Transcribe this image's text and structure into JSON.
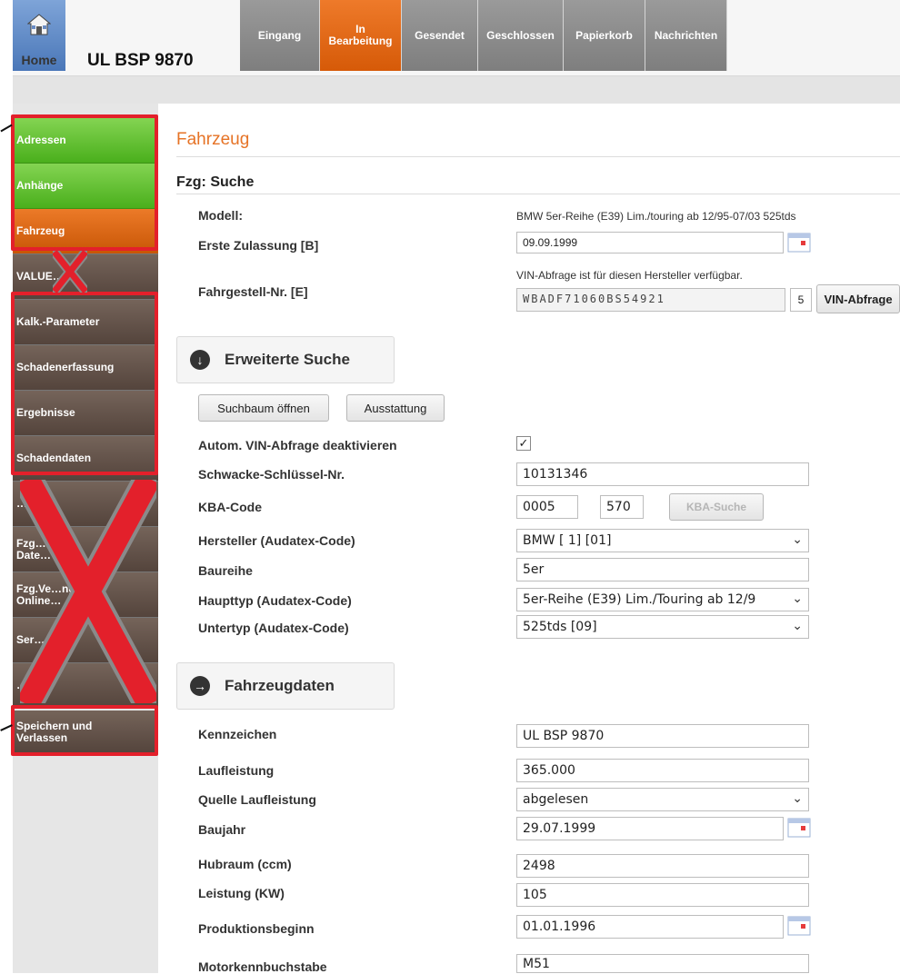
{
  "header": {
    "home_label": "Home",
    "car_title": "UL BSP 9870",
    "tabs": [
      {
        "label": "Eingang"
      },
      {
        "label": "In Bearbeitung"
      },
      {
        "label": "Gesendet"
      },
      {
        "label": "Geschlossen"
      },
      {
        "label": "Papierkorb"
      },
      {
        "label": "Nachrichten"
      }
    ]
  },
  "sidebar": {
    "items": [
      {
        "label": "Adressen"
      },
      {
        "label": "Anhänge"
      },
      {
        "label": "Fahrzeug"
      },
      {
        "label": "VALUE…pt"
      },
      {
        "label": "Kalk.-Parameter"
      },
      {
        "label": "Schadenerfassung"
      },
      {
        "label": "Ergebnisse"
      },
      {
        "label": "Schadendaten"
      },
      {
        "label": "…"
      },
      {
        "label": "Fzg…\nDate…"
      },
      {
        "label": "Fzg.Ve…ng\nOnline…"
      },
      {
        "label": "Ser…"
      },
      {
        "label": "…"
      },
      {
        "label": "Speichern und\nVerlassen"
      }
    ]
  },
  "main": {
    "section_title": "Fahrzeug",
    "search_title": "Fzg: Suche",
    "modell_label": "Modell:",
    "modell_value": "BMW 5er-Reihe (E39) Lim./touring ab 12/95-07/03 525tds",
    "erstzulassung_label": "Erste Zulassung [B]",
    "erstzulassung_value": "09.09.1999",
    "vin_hint": "VIN-Abfrage ist für diesen Hersteller verfügbar.",
    "fahrgestell_label": "Fahrgestell-Nr. [E]",
    "vin_value": "WBADF71060BS54921",
    "vin_check": "5",
    "vin_button": "VIN-Abfrage",
    "erweiterte_suche": "Erweiterte Suche",
    "suchbaum_button": "Suchbaum öffnen",
    "ausstattung_button": "Ausstattung",
    "autom_vin_label": "Autom. VIN-Abfrage deaktivieren",
    "autom_vin_checked": "✓",
    "schwacke_label": "Schwacke-Schlüssel-Nr.",
    "schwacke_value": "10131346",
    "kba_label": "KBA-Code",
    "kba_value1": "0005",
    "kba_value2": "570",
    "kba_button": "KBA-Suche",
    "hersteller_label": "Hersteller (Audatex-Code)",
    "hersteller_value": "BMW [ 1] [01]",
    "baureihe_label": "Baureihe",
    "baureihe_value": "5er",
    "haupttyp_label": "Haupttyp (Audatex-Code)",
    "haupttyp_value": "5er-Reihe (E39) Lim./Touring ab 12/9",
    "untertyp_label": "Untertyp (Audatex-Code)",
    "untertyp_value": "525tds [09]",
    "fahrzeugdaten": "Fahrzeugdaten",
    "kennzeichen_label": "Kennzeichen",
    "kennzeichen_value": "UL BSP 9870",
    "laufleistung_label": "Laufleistung",
    "laufleistung_value": "365.000",
    "quelle_label": "Quelle Laufleistung",
    "quelle_value": "abgelesen",
    "baujahr_label": "Baujahr",
    "baujahr_value": "29.07.1999",
    "hubraum_label": "Hubraum (ccm)",
    "hubraum_value": "2498",
    "leistung_label": "Leistung (KW)",
    "leistung_value": "105",
    "produktion_label": "Produktionsbeginn",
    "produktion_value": "01.01.1996",
    "motor_label": "Motorkennbuchstabe",
    "motor_value": "M51"
  },
  "colors": {
    "accent_orange": "#e67326",
    "active_green": "#5cbf2a",
    "annotation_red": "#e3202b"
  }
}
